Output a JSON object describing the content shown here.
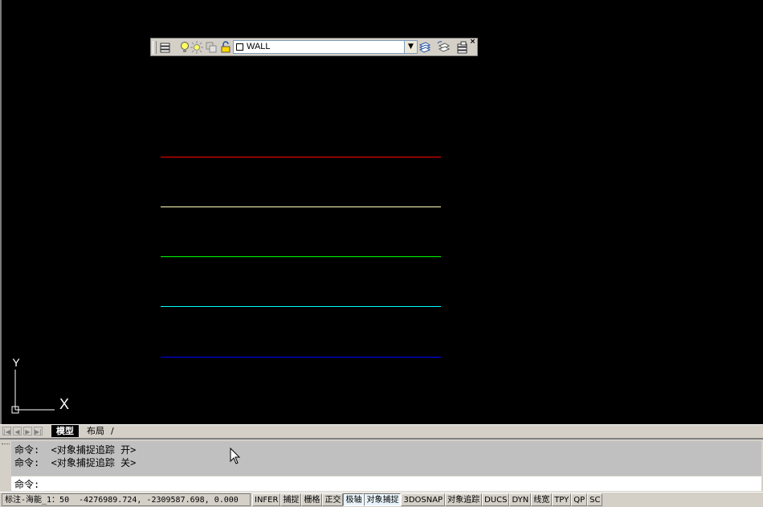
{
  "layer_toolbar": {
    "current_layer": "WALL",
    "close_glyph": "×",
    "icons": [
      "layer-manager-icon",
      "bulb-icon",
      "sun-icon",
      "viewport-freeze-icon",
      "lock-icon",
      "color-square-icon",
      "make-current-icon",
      "layer-previous-icon",
      "layer-states-icon"
    ]
  },
  "drawing": {
    "lines": [
      {
        "name": "red-line",
        "color": "#ff0000"
      },
      {
        "name": "yellow-line",
        "color": "#ffffc0"
      },
      {
        "name": "green-line",
        "color": "#00ff00"
      },
      {
        "name": "cyan-line",
        "color": "#00ffff"
      },
      {
        "name": "blue-line",
        "color": "#0000ff"
      }
    ],
    "ucs": {
      "x_label": "X",
      "y_label": "Y"
    }
  },
  "tabs": {
    "model": "模型",
    "layout": "布局"
  },
  "command": {
    "history": [
      "命令:  <对象捕捉追踪 开>",
      "命令:  <对象捕捉追踪 关>"
    ],
    "prompt": "命令:"
  },
  "status": {
    "annotation": "标注-海能_1：50  -4276989.724, -2309587.698, 0.000",
    "toggles": [
      {
        "label": "INFER",
        "on": false
      },
      {
        "label": "捕捉",
        "on": false
      },
      {
        "label": "栅格",
        "on": false
      },
      {
        "label": "正交",
        "on": false
      },
      {
        "label": "极轴",
        "on": true
      },
      {
        "label": "对象捕捉",
        "on": true
      },
      {
        "label": "3DOSNAP",
        "on": false
      },
      {
        "label": "对象追踪",
        "on": false
      },
      {
        "label": "DUCS",
        "on": false
      },
      {
        "label": "DYN",
        "on": false
      },
      {
        "label": "线宽",
        "on": false
      },
      {
        "label": "TPY",
        "on": false
      },
      {
        "label": "QP",
        "on": false
      },
      {
        "label": "SC",
        "on": false
      }
    ]
  }
}
